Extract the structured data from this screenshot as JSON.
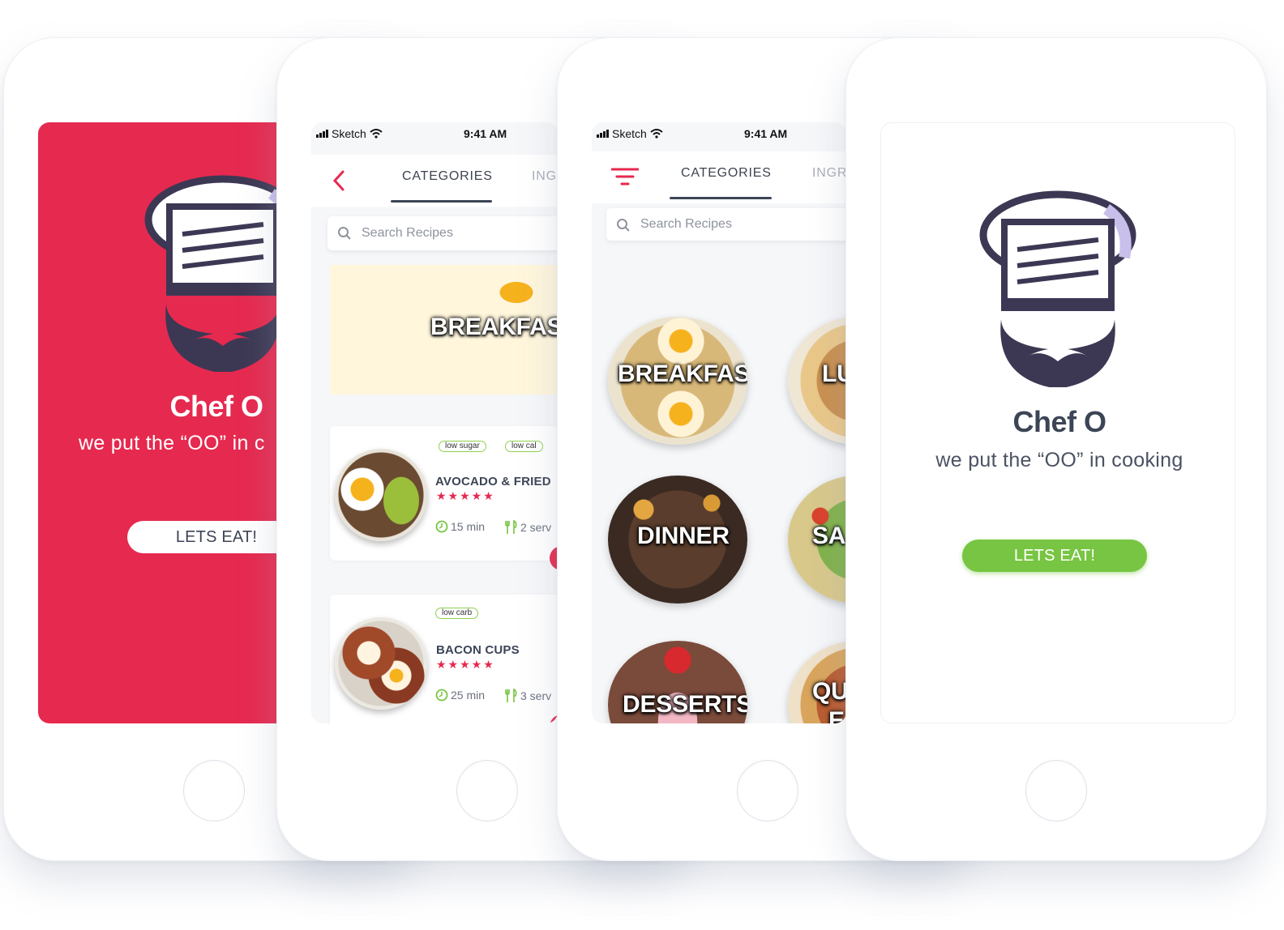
{
  "brand": {
    "app_name": "Chef O",
    "tagline_full": "we put the “OO” in cooking",
    "tagline_clipped": "we put the “OO” in c",
    "cta_label": "LETS EAT!",
    "colors": {
      "red": "#e6294f",
      "navy": "#3c3854",
      "lavender": "#c9bfeb",
      "green": "#77c542",
      "white": "#ffffff"
    }
  },
  "status_bar": {
    "carrier": "Sketch",
    "time": "9:41 AM"
  },
  "tabs": {
    "active": "CATEGORIES",
    "next": "INGR",
    "next_alt": "INGRI"
  },
  "search": {
    "placeholder": "Search Recipes"
  },
  "featured": {
    "label": "BREAKFAST"
  },
  "recipes": [
    {
      "tags": [
        "low sugar",
        "low cal"
      ],
      "title": "AVOCADO & FRIED",
      "stars": "★★★★★",
      "time": "15 min",
      "servings": "2 serv"
    },
    {
      "tags": [
        "low carb"
      ],
      "title": "BACON CUPS",
      "stars": "★★★★★",
      "time": "25 min",
      "servings": "3 serv"
    }
  ],
  "categories": [
    {
      "label": "BREAKFAST"
    },
    {
      "label": "LU"
    },
    {
      "label": "DINNER"
    },
    {
      "label": "SA"
    },
    {
      "label": "DESSERTS"
    },
    {
      "label_line1": "QU",
      "label_line2": "E"
    }
  ],
  "icons": [
    "signal-icon",
    "wifi-icon",
    "back-chevron-icon",
    "filter-icon",
    "search-icon",
    "clock-icon",
    "utensils-icon",
    "chef-logo-icon"
  ]
}
